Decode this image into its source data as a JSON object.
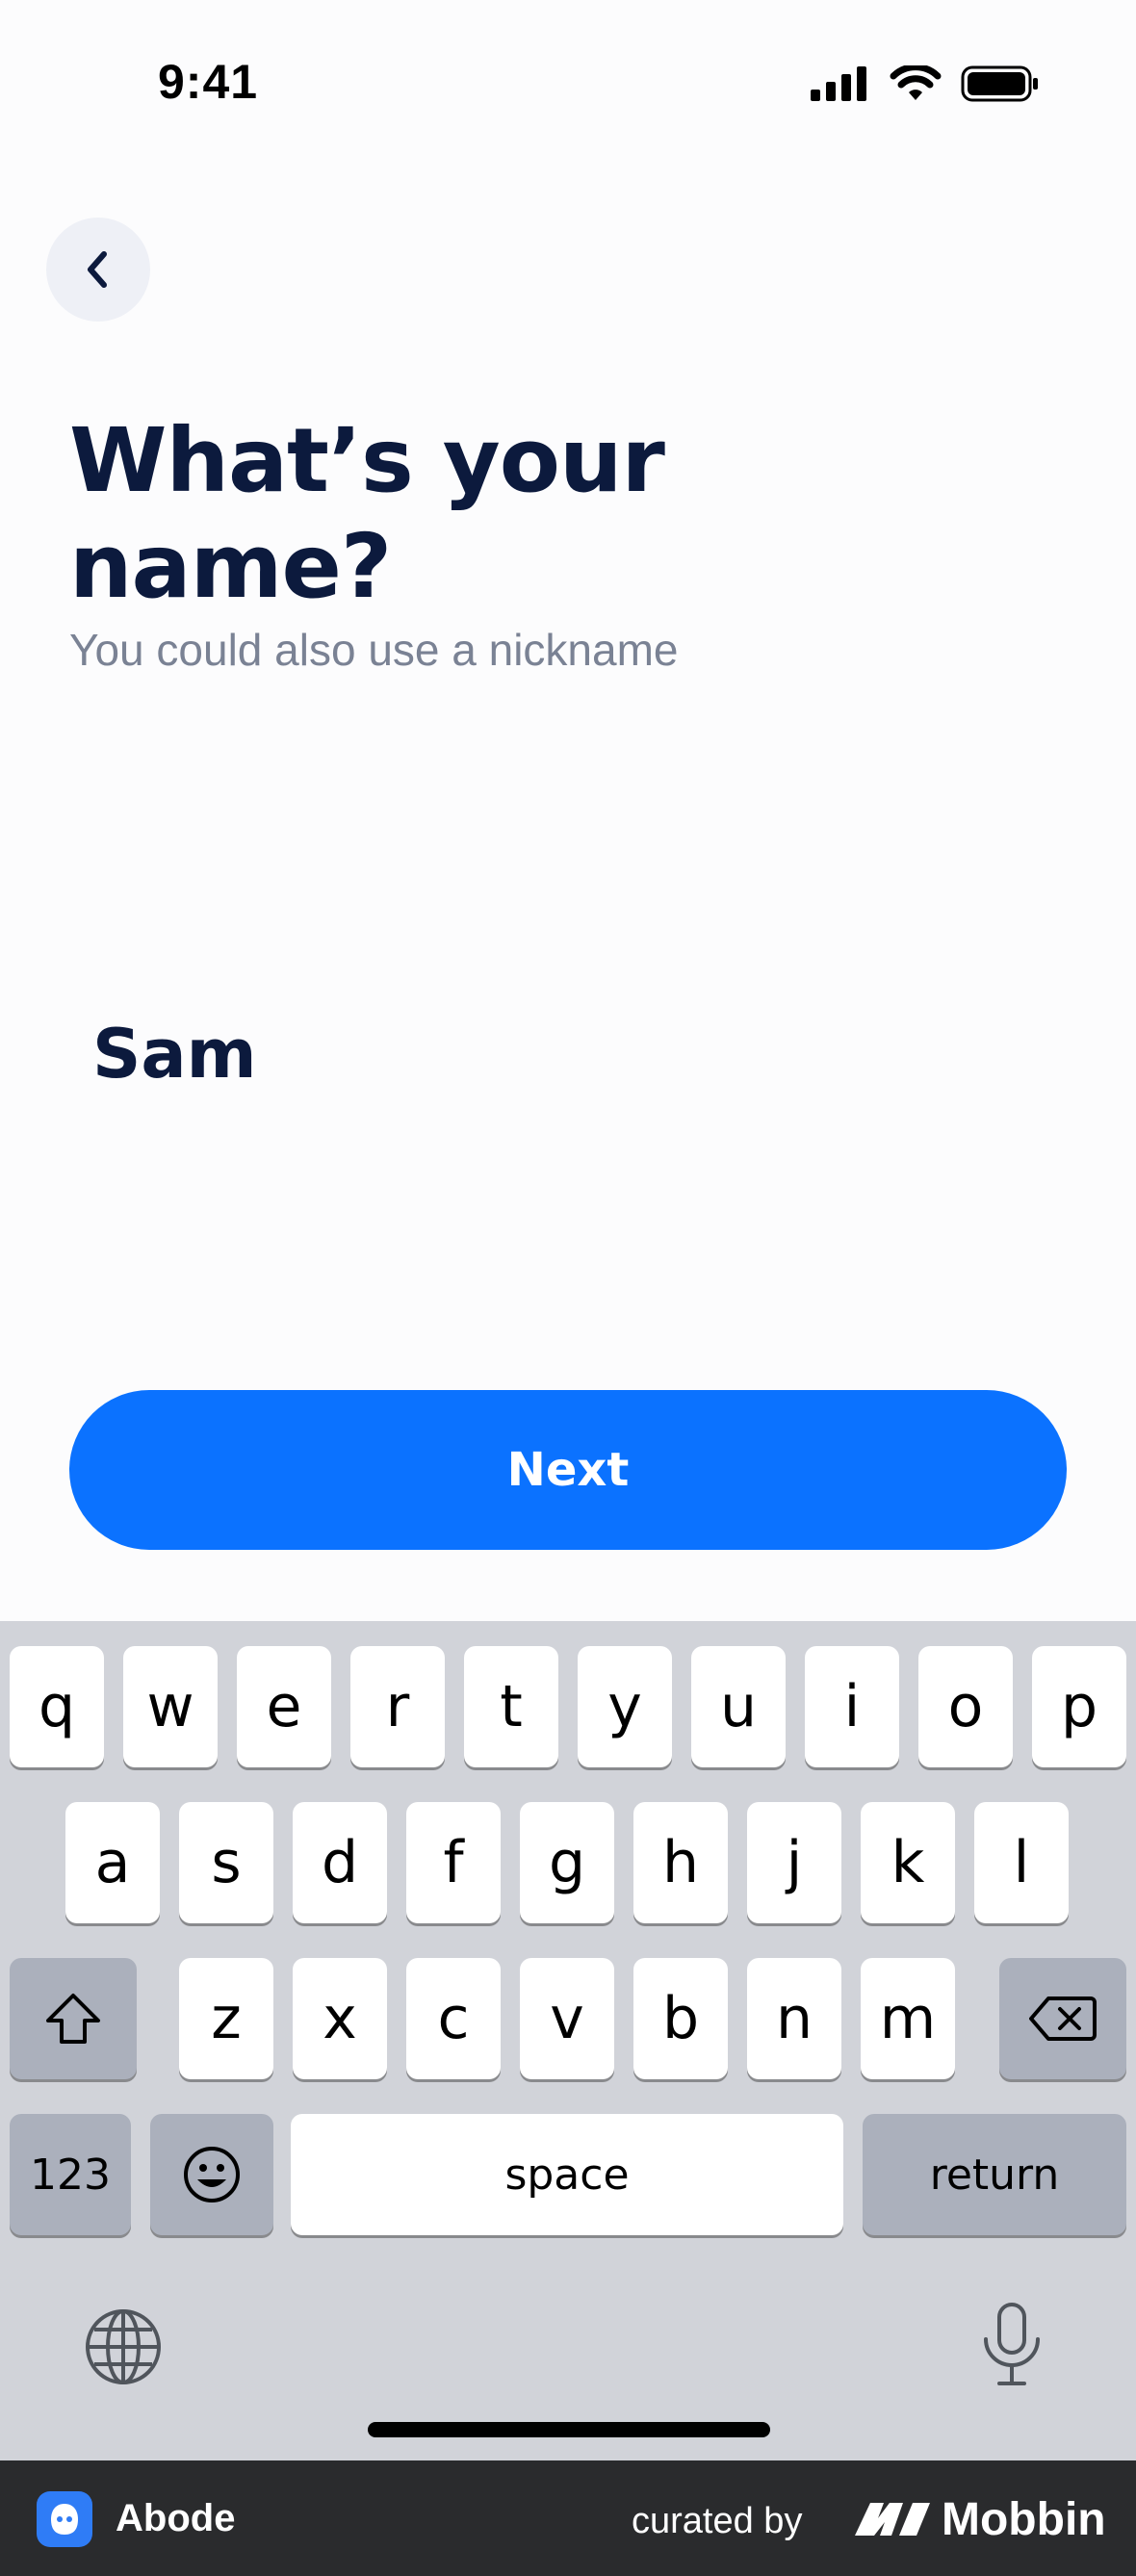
{
  "status_bar": {
    "time": "9:41"
  },
  "screen": {
    "title": "What’s your name?",
    "subtitle": "You could also use a nickname",
    "name_value": "Sam",
    "next_label": "Next"
  },
  "keyboard": {
    "row1": [
      "q",
      "w",
      "e",
      "r",
      "t",
      "y",
      "u",
      "i",
      "o",
      "p"
    ],
    "row2": [
      "a",
      "s",
      "d",
      "f",
      "g",
      "h",
      "j",
      "k",
      "l"
    ],
    "row3": [
      "z",
      "x",
      "c",
      "v",
      "b",
      "n",
      "m"
    ],
    "numbers_label": "123",
    "space_label": "space",
    "return_label": "return",
    "icons": [
      "shift-icon",
      "delete-icon",
      "emoji-icon",
      "globe-icon",
      "microphone-icon"
    ]
  },
  "footer": {
    "app_name": "Abode",
    "curated_label": "curated by",
    "brand": "Mobbin"
  },
  "colors": {
    "accent": "#0b72ff",
    "title": "#0c1a3d",
    "subtitle": "#7a8294"
  }
}
